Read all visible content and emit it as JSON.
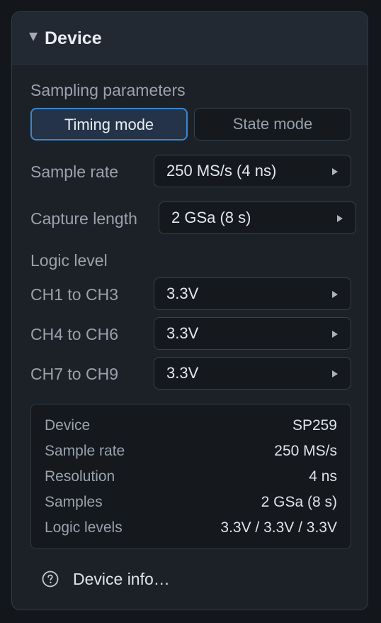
{
  "panel": {
    "title": "Device",
    "collapse_icon": "caret-down-icon"
  },
  "sampling": {
    "heading": "Sampling parameters",
    "modes": [
      {
        "label": "Timing mode",
        "selected": true
      },
      {
        "label": "State mode",
        "selected": false
      }
    ]
  },
  "sample_rate": {
    "label": "Sample rate",
    "value": "250 MS/s (4 ns)"
  },
  "capture_length": {
    "label": "Capture length",
    "value": "2 GSa (8 s)"
  },
  "logic_level": {
    "heading": "Logic level",
    "channels": [
      {
        "label": "CH1 to CH3",
        "value": "3.3V"
      },
      {
        "label": "CH4 to CH6",
        "value": "3.3V"
      },
      {
        "label": "CH7 to CH9",
        "value": "3.3V"
      }
    ]
  },
  "summary": {
    "rows": [
      {
        "key": "Device",
        "value": "SP259"
      },
      {
        "key": "Sample rate",
        "value": "250 MS/s"
      },
      {
        "key": "Resolution",
        "value": "4 ns"
      },
      {
        "key": "Samples",
        "value": "2 GSa (8 s)"
      },
      {
        "key": "Logic levels",
        "value": "3.3V / 3.3V / 3.3V"
      }
    ]
  },
  "device_info": {
    "label": "Device info…",
    "icon": "help-circle-icon"
  },
  "colors": {
    "accent": "#3d87cc",
    "panel_bg": "#1c2128",
    "header_bg": "#232932",
    "field_bg": "#15181d"
  }
}
